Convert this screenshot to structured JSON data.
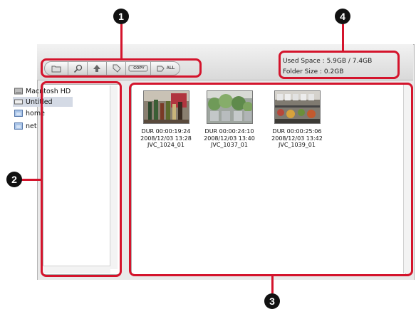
{
  "callouts": [
    "1",
    "2",
    "3",
    "4"
  ],
  "info": {
    "used_space": "Used Space : 5.9GB / 7.4GB",
    "folder_size": "Folder Size : 0.2GB"
  },
  "toolbar": {
    "buttons": [
      "new-folder-icon",
      "search-icon",
      "up-arrow-icon",
      "select-icon",
      "copy-icon",
      "copy-all-icon"
    ],
    "copy_label": "COPY",
    "copy_all_label": "ALL"
  },
  "sidebar": {
    "items": [
      {
        "label": "Macntosh HD",
        "icon": "hard-drive-icon"
      },
      {
        "label": "Untitled",
        "icon": "drive-icon",
        "selected": true
      },
      {
        "label": "home",
        "icon": "network-folder-icon"
      },
      {
        "label": "net",
        "icon": "network-folder-icon"
      }
    ]
  },
  "clips": [
    {
      "duration": "DUR 00:00:19:24",
      "date": "2008/12/03 13:28",
      "name": "JVC_1024_01"
    },
    {
      "duration": "DUR 00:00:24:10",
      "date": "2008/12/03 13:40",
      "name": "JVC_1037_01"
    },
    {
      "duration": "DUR 00:00:25:06",
      "date": "2008/12/03 13:42",
      "name": "JVC_1039_01"
    }
  ],
  "colors": {
    "callout": "#d4142c",
    "selection": "#d4dae5"
  }
}
